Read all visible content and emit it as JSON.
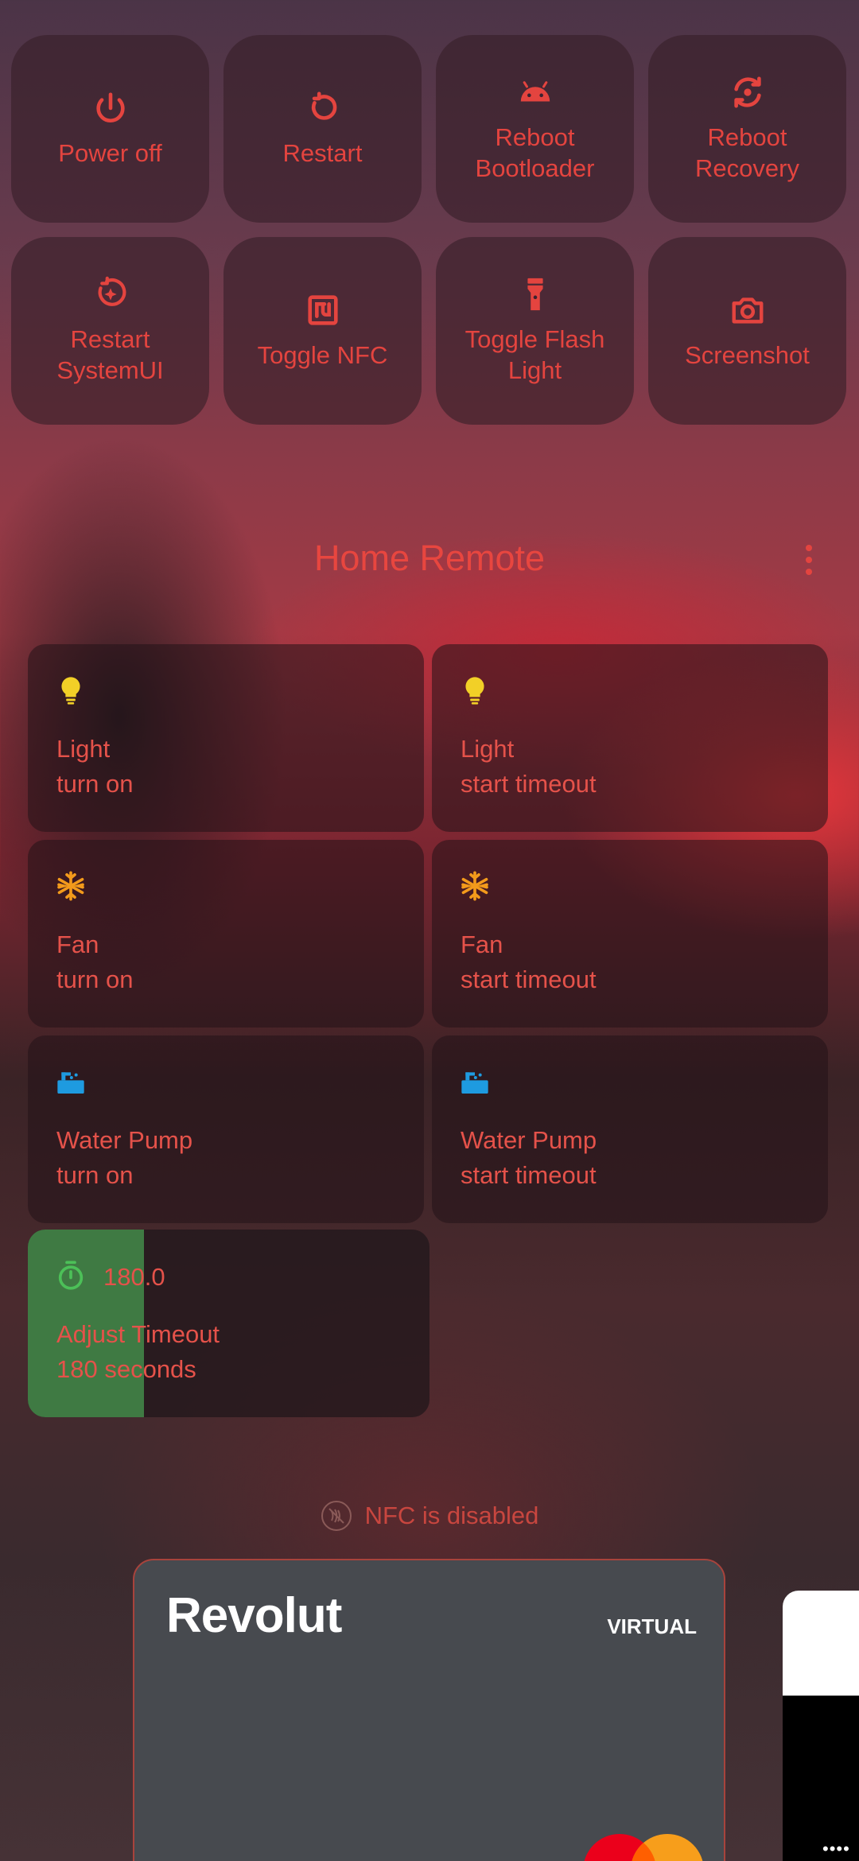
{
  "quick_actions": [
    {
      "label": "Power off",
      "icon": "power-icon"
    },
    {
      "label": "Restart",
      "icon": "restart-icon"
    },
    {
      "label": "Reboot\nBootloader",
      "icon": "android-icon"
    },
    {
      "label": "Reboot\nRecovery",
      "icon": "recovery-icon"
    },
    {
      "label": "Restart\nSystemUI",
      "icon": "systemui-icon"
    },
    {
      "label": "Toggle NFC",
      "icon": "nfc-icon"
    },
    {
      "label": "Toggle Flash\nLight",
      "icon": "flashlight-icon"
    },
    {
      "label": "Screenshot",
      "icon": "camera-icon"
    }
  ],
  "home_remote": {
    "title": "Home Remote",
    "cards": [
      {
        "name": "Light",
        "action": "turn on",
        "icon": "lightbulb-icon",
        "color": "#f2d027"
      },
      {
        "name": "Light",
        "action": "start timeout",
        "icon": "lightbulb-icon",
        "color": "#f2d027"
      },
      {
        "name": "Fan",
        "action": "turn on",
        "icon": "fan-icon",
        "color": "#f39a1b"
      },
      {
        "name": "Fan",
        "action": "start timeout",
        "icon": "fan-icon",
        "color": "#f39a1b"
      },
      {
        "name": "Water Pump",
        "action": "turn on",
        "icon": "water-pump-icon",
        "color": "#1e9be0"
      },
      {
        "name": "Water Pump",
        "action": "start timeout",
        "icon": "water-pump-icon",
        "color": "#1e9be0"
      }
    ],
    "timeout": {
      "value": "180.0",
      "name": "Adjust Timeout",
      "detail": "180 seconds",
      "level": 0.29,
      "icon": "timer-icon",
      "color": "#4cc058"
    }
  },
  "wallet": {
    "nfc_status": "NFC is disabled",
    "card_brand": "Revolut",
    "card_type": "VIRTUAL",
    "side_card_digits": "••••"
  },
  "colors": {
    "accent": "#e4443f",
    "tile_bg": "#37202a"
  }
}
